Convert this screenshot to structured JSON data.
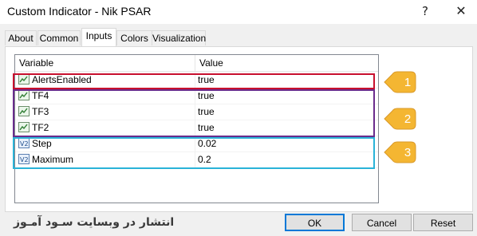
{
  "window": {
    "title": "Custom Indicator - Nik PSAR",
    "help_label": "?",
    "close_label": "✕"
  },
  "tabs": [
    {
      "label": "About",
      "active": false
    },
    {
      "label": "Common",
      "active": false
    },
    {
      "label": "Inputs",
      "active": true
    },
    {
      "label": "Colors",
      "active": false
    },
    {
      "label": "Visualization",
      "active": false
    }
  ],
  "table": {
    "columns": [
      "Variable",
      "Value"
    ],
    "rows": [
      {
        "name": "AlertsEnabled",
        "value": "true",
        "icon": "boolean-param-icon"
      },
      {
        "name": "TF4",
        "value": "true",
        "icon": "boolean-param-icon"
      },
      {
        "name": "TF3",
        "value": "true",
        "icon": "boolean-param-icon"
      },
      {
        "name": "TF2",
        "value": "true",
        "icon": "boolean-param-icon"
      },
      {
        "name": "Step",
        "value": "0.02",
        "icon": "number-param-icon",
        "icon_text": "V2"
      },
      {
        "name": "Maximum",
        "value": "0.2",
        "icon": "number-param-icon",
        "icon_text": "V2"
      }
    ]
  },
  "callouts": [
    {
      "label": "1",
      "color": "#f4b632"
    },
    {
      "label": "2",
      "color": "#f4b632"
    },
    {
      "label": "3",
      "color": "#f4b632"
    }
  ],
  "highlight_colors": {
    "group1": "#c8102e",
    "group2": "#6a2c8c",
    "group3": "#2ab3d8"
  },
  "buttons": {
    "ok": "OK",
    "cancel": "Cancel",
    "reset": "Reset"
  },
  "watermark": "انتشار در وبسایت سـود آمـوز"
}
